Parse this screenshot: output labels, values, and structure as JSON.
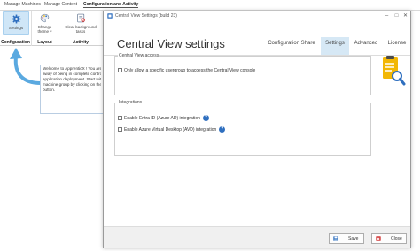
{
  "app": {
    "tabs": [
      "Manage Machines",
      "Manage Content",
      "Configuration and Activity"
    ],
    "ribbon": {
      "settings_label": "Settings",
      "configuration_group": "Configuration",
      "change_theme_line1": "Change",
      "change_theme_line2": "theme",
      "layout_group": "Layout",
      "clear_tasks_line1": "Clear background",
      "clear_tasks_line2": "tasks",
      "activity_group": "Activity"
    },
    "callout_lines": [
      "Welcome to ApprenticX ! You are one",
      "away of being in complete control",
      "application deployment. Start with",
      "machine group by clicking on the",
      "button."
    ]
  },
  "dialog": {
    "window_title": "Central View Settings (build 23)",
    "page_title": "Central View settings",
    "nav_tabs": [
      "Configuration Share",
      "Settings",
      "Advanced",
      "License"
    ],
    "active_tab": "Settings",
    "access_group": {
      "label": "Central View access",
      "option": "Only allow a specific usergroup to access the Central View console",
      "checked": false
    },
    "integrations_group": {
      "label": "Integrations",
      "options": [
        {
          "label": "Enable Entra ID (Azure AD) integration",
          "checked": false
        },
        {
          "label": "Enable Azure Virtual Desktop (AVD) integration",
          "checked": false
        }
      ]
    },
    "help_glyph": "?",
    "save_label": "Save",
    "close_label": "Close"
  },
  "colors": {
    "accent": "#2f6fbf",
    "active_tab_bg": "#d6e8f5",
    "arrow": "#5aa9e0",
    "clipboard_yellow": "#f2b705",
    "save_icon": "#2f6fbf",
    "close_icon": "#d23b3b"
  },
  "icons": {
    "settings": "gear-icon",
    "change_theme": "palette-icon",
    "clear_tasks": "clear-tasks-icon",
    "dialog_app": "app-icon",
    "config_graphic": "clipboard-search-icon",
    "save": "save-icon",
    "close": "close-icon"
  }
}
